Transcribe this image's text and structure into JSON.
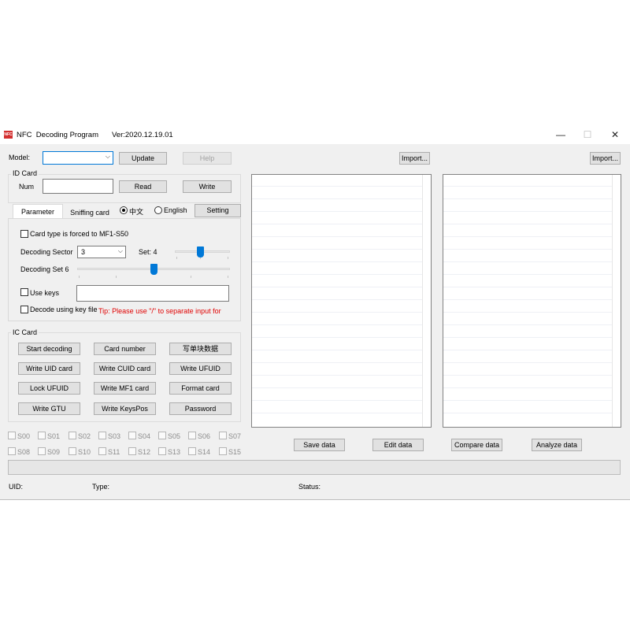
{
  "window": {
    "app_icon": "NFC",
    "title": "NFC  Decoding Program",
    "version": "Ver:2020.12.19.01",
    "controls": {
      "minimize": "—",
      "maximize": "☐",
      "close": "✕"
    }
  },
  "top": {
    "model_label": "Model:",
    "model_value": "",
    "update": "Update",
    "help": "Help",
    "import_left": "Import...",
    "import_right": "Import..."
  },
  "id_card": {
    "title": "ID Card",
    "num_label": "Num",
    "num_value": "",
    "read": "Read",
    "write": "Write"
  },
  "tabs": [
    "Parameter",
    "Sniffing card"
  ],
  "language": {
    "chinese": "中文",
    "english": "English",
    "selected": "中文"
  },
  "setting": "Setting",
  "params": {
    "forced_label": "Card type is forced to MF1-S50",
    "sector_label": "Decoding Sector",
    "sector_value": "3",
    "set_label": "Set: 4",
    "set_level": 0.45,
    "decoding_set_label": "Decoding Set 6",
    "decoding_set_level": 0.5,
    "use_keys": "Use keys",
    "keys_value": "",
    "key_file": "Decode using key file",
    "tip": "Tip: Please use \"/\" to separate input for"
  },
  "ic_card": {
    "title": "IC Card",
    "buttons": [
      [
        "Start decoding",
        "Card number",
        "写单块数据"
      ],
      [
        "Write UID card",
        "Write CUID card",
        "Write UFUID"
      ],
      [
        "Lock UFUID",
        "Write MF1 card",
        "Format card"
      ],
      [
        "Write GTU",
        "Write KeysPos",
        "Password"
      ]
    ]
  },
  "sectors": [
    [
      "S00",
      "S01",
      "S02",
      "S03",
      "S04",
      "S05",
      "S06",
      "S07"
    ],
    [
      "S08",
      "S09",
      "S10",
      "S11",
      "S12",
      "S13",
      "S14",
      "S15"
    ]
  ],
  "actions": {
    "save": "Save data",
    "edit": "Edit data",
    "compare": "Compare data",
    "analyze": "Analyze data"
  },
  "status_bar": {
    "uid_label": "UID:",
    "type_label": "Type:",
    "status_label": "Status:"
  },
  "colors": {
    "accent": "#0078d7",
    "tip": "#e00000",
    "window_bg": "#f0f0f0"
  }
}
